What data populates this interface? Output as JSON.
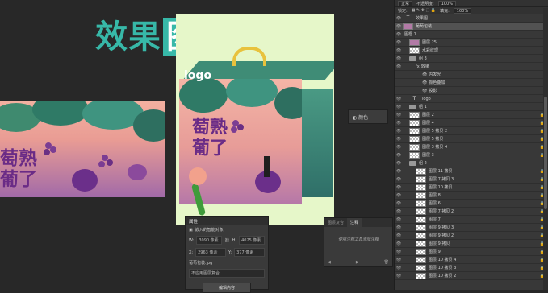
{
  "title": {
    "part1": "效果",
    "part2": "图"
  },
  "banner": {
    "text_line1": "萄熟",
    "text_line2": "葡了"
  },
  "poster": {
    "logo": "logo",
    "text_line1": "萄熟",
    "text_line2": "葡了"
  },
  "color_panel": {
    "label": "颜色"
  },
  "properties": {
    "tab": "属性",
    "object_type": "嵌入的智能对象",
    "w_label": "W:",
    "w_value": "3090 像素",
    "h_label": "H:",
    "h_value": "4025 像素",
    "x_label": "X:",
    "x_value": "2963 像素",
    "y_label": "Y:",
    "y_value": "377 像素",
    "filename": "葡萄包装.jpg",
    "placeholder": "不应用图层复合",
    "edit_button": "编辑内容"
  },
  "notes": {
    "tab1": "图层复合",
    "tab2": "注释",
    "empty_hint": "使用注释工具添加注释"
  },
  "layers_header": {
    "blend_mode": "正常",
    "opacity_label": "不透明度:",
    "opacity_value": "100%",
    "lock_label": "锁定:",
    "fill_label": "填充:",
    "fill_value": "100%"
  },
  "layers": [
    {
      "name": "效果图",
      "kind": "text",
      "indent": 0,
      "selected": false,
      "lock": false
    },
    {
      "name": "葡萄包装",
      "kind": "img",
      "indent": 0,
      "selected": true,
      "lock": false
    },
    {
      "name": "图框 1",
      "kind": "none",
      "indent": 0,
      "selected": false,
      "lock": false
    },
    {
      "name": "图层 25",
      "kind": "img",
      "indent": 1,
      "selected": false,
      "lock": false
    },
    {
      "name": "水彩纹理",
      "kind": "thumb",
      "indent": 1,
      "selected": false,
      "lock": false
    },
    {
      "name": "组 3",
      "kind": "folder",
      "indent": 1,
      "selected": false,
      "lock": false
    },
    {
      "name": "效果",
      "kind": "fx",
      "indent": 2,
      "selected": false,
      "lock": false
    },
    {
      "name": "内发光",
      "kind": "fx",
      "indent": 3,
      "selected": false,
      "lock": false
    },
    {
      "name": "颜色叠加",
      "kind": "fx",
      "indent": 3,
      "selected": false,
      "lock": false
    },
    {
      "name": "投影",
      "kind": "fx",
      "indent": 3,
      "selected": false,
      "lock": false
    },
    {
      "name": "logo",
      "kind": "text",
      "indent": 1,
      "selected": false,
      "lock": false
    },
    {
      "name": "组 1",
      "kind": "folder",
      "indent": 1,
      "selected": false,
      "lock": false
    },
    {
      "name": "图层 2",
      "kind": "thumb",
      "indent": 1,
      "selected": false,
      "lock": true
    },
    {
      "name": "图层 4",
      "kind": "thumb",
      "indent": 1,
      "selected": false,
      "lock": true
    },
    {
      "name": "图层 5 拷贝 2",
      "kind": "thumb",
      "indent": 1,
      "selected": false,
      "lock": true
    },
    {
      "name": "图层 5 拷贝",
      "kind": "thumb",
      "indent": 1,
      "selected": false,
      "lock": true
    },
    {
      "name": "图层 3 拷贝 4",
      "kind": "thumb",
      "indent": 1,
      "selected": false,
      "lock": true
    },
    {
      "name": "图层 3",
      "kind": "thumb",
      "indent": 1,
      "selected": false,
      "lock": true
    },
    {
      "name": "组 2",
      "kind": "folder",
      "indent": 1,
      "selected": false,
      "lock": false
    },
    {
      "name": "图层 11 拷贝",
      "kind": "thumb",
      "indent": 2,
      "selected": false,
      "lock": true
    },
    {
      "name": "图层 7 拷贝 3",
      "kind": "thumb",
      "indent": 2,
      "selected": false,
      "lock": true
    },
    {
      "name": "图层 10 拷贝",
      "kind": "thumb",
      "indent": 2,
      "selected": false,
      "lock": true
    },
    {
      "name": "图层 8",
      "kind": "thumb",
      "indent": 2,
      "selected": false,
      "lock": true
    },
    {
      "name": "图层 6",
      "kind": "thumb",
      "indent": 2,
      "selected": false,
      "lock": true
    },
    {
      "name": "图层 7 拷贝 2",
      "kind": "thumb",
      "indent": 2,
      "selected": false,
      "lock": true
    },
    {
      "name": "图层 7",
      "kind": "thumb",
      "indent": 2,
      "selected": false,
      "lock": true
    },
    {
      "name": "图层 9 拷贝 3",
      "kind": "thumb",
      "indent": 2,
      "selected": false,
      "lock": true
    },
    {
      "name": "图层 9 拷贝 2",
      "kind": "thumb",
      "indent": 2,
      "selected": false,
      "lock": true
    },
    {
      "name": "图层 9 拷贝",
      "kind": "thumb",
      "indent": 2,
      "selected": false,
      "lock": true
    },
    {
      "name": "图层 9",
      "kind": "thumb",
      "indent": 2,
      "selected": false,
      "lock": true
    },
    {
      "name": "图层 10 拷贝 4",
      "kind": "thumb",
      "indent": 2,
      "selected": false,
      "lock": true
    },
    {
      "name": "图层 10 拷贝 3",
      "kind": "thumb",
      "indent": 2,
      "selected": false,
      "lock": true
    },
    {
      "name": "图层 10 拷贝 2",
      "kind": "thumb",
      "indent": 2,
      "selected": false,
      "lock": true
    }
  ]
}
